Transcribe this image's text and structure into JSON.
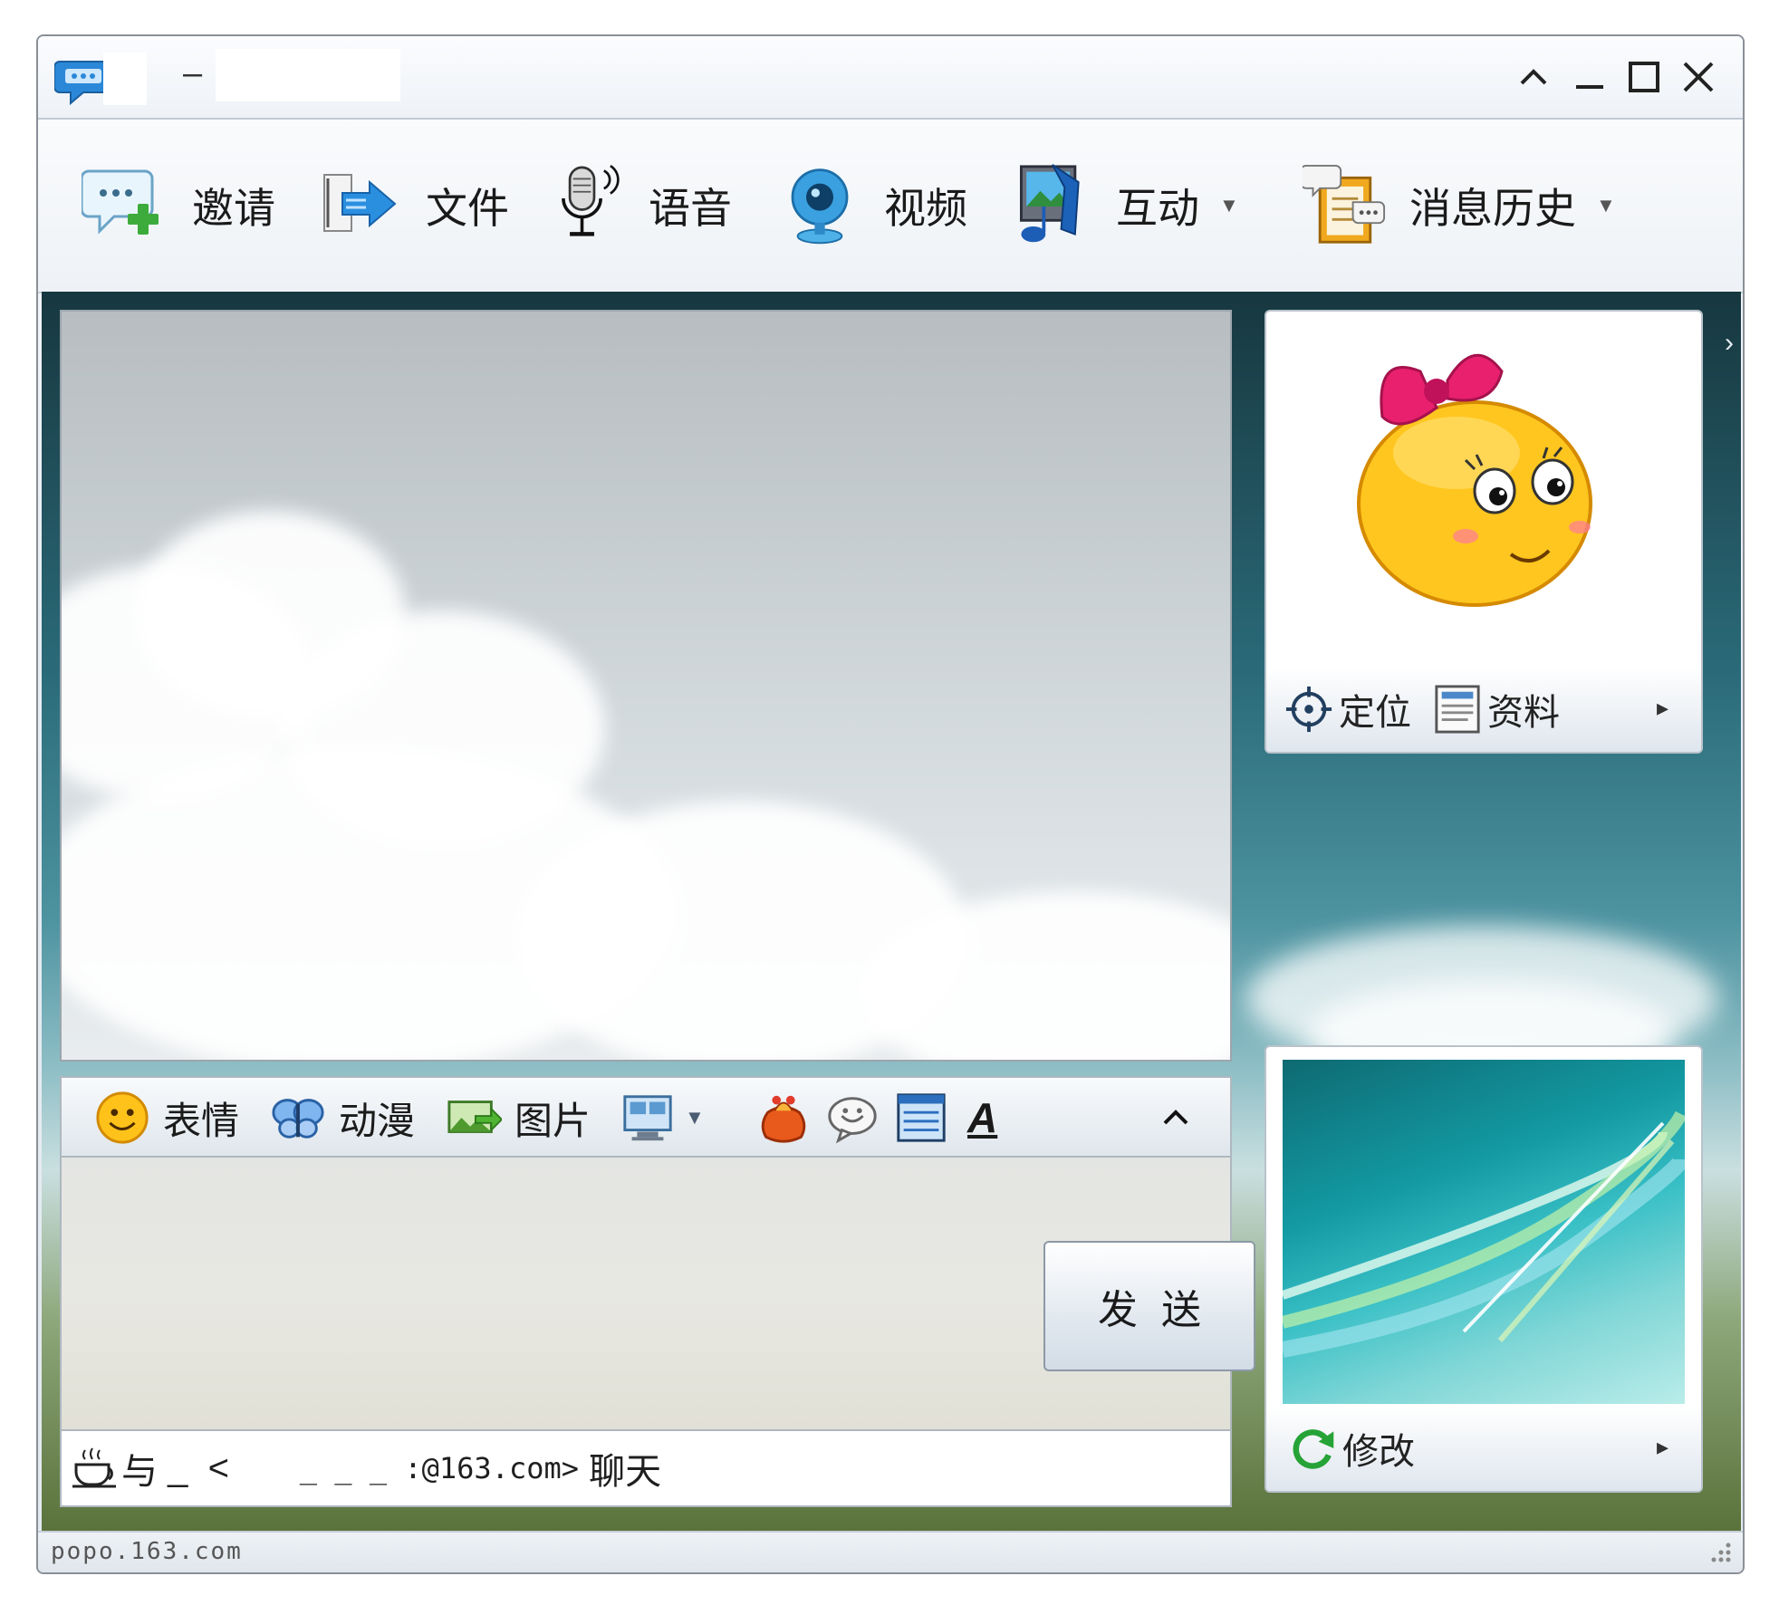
{
  "window": {
    "title_separator": "–",
    "controls": [
      "collapse-icon",
      "minimize-icon",
      "maximize-icon",
      "close-icon"
    ]
  },
  "toolbar": {
    "items": [
      {
        "label": "邀请",
        "icon": "invite-icon"
      },
      {
        "label": "文件",
        "icon": "file-transfer-icon"
      },
      {
        "label": "语音",
        "icon": "microphone-icon"
      },
      {
        "label": "视频",
        "icon": "webcam-icon"
      },
      {
        "label": "互动",
        "icon": "interact-icon",
        "has_dropdown": true
      },
      {
        "label": "消息历史",
        "icon": "message-history-icon",
        "has_dropdown": true
      }
    ],
    "dropdown_glyph": "▼"
  },
  "input_toolbar": {
    "emoticon_label": "表情",
    "anime_label": "动漫",
    "picture_label": "图片",
    "font_label": "A",
    "collapse_glyph": "︿"
  },
  "send_button": {
    "label": "发送"
  },
  "status_line": {
    "prefix": "与",
    "middle": " _  <       ",
    "email": "_ _ _ :@163.com>",
    "suffix": " 聊天"
  },
  "contact_panel": {
    "locate_label": "定位",
    "profile_label": "资料",
    "more_glyph": "▸"
  },
  "self_panel": {
    "modify_label": "修改",
    "more_glyph": "▸"
  },
  "side_toggle_glyph": "›",
  "statusbar": {
    "url": "popo.163.com"
  },
  "colors": {
    "window_bg": "#e9eef4",
    "content_bg": "#0c3d4a",
    "accent": "#1e8fd0"
  }
}
